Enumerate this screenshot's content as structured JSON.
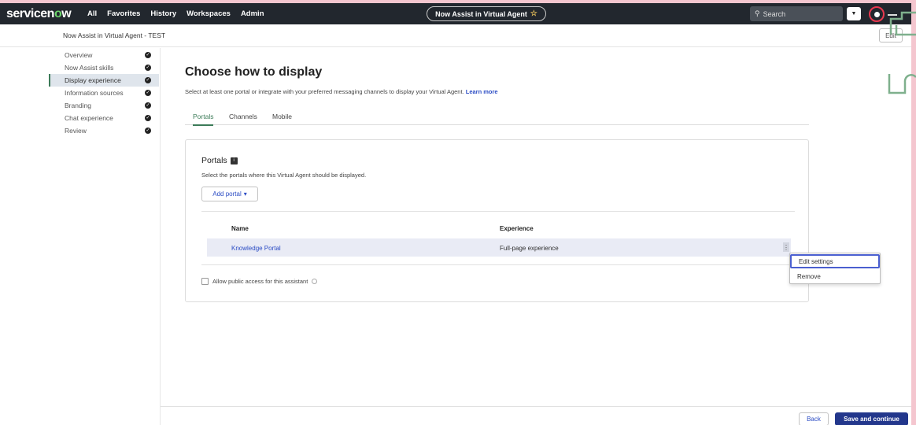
{
  "topnav": {
    "logo_pre": "servicen",
    "logo_o": "o",
    "logo_post": "w",
    "items": [
      "All",
      "Favorites",
      "History",
      "Workspaces",
      "Admin"
    ],
    "context_pill": "Now Assist in Virtual Agent",
    "search_placeholder": "Search"
  },
  "header": {
    "title": "Now Assist in Virtual Agent - TEST",
    "edit_label": "Edit"
  },
  "steps": [
    {
      "label": "Overview",
      "done": true
    },
    {
      "label": "Now Assist skills",
      "done": true
    },
    {
      "label": "Display experience",
      "done": true,
      "active": true
    },
    {
      "label": "Information sources",
      "done": true
    },
    {
      "label": "Branding",
      "done": true
    },
    {
      "label": "Chat experience",
      "done": true
    },
    {
      "label": "Review",
      "done": true
    }
  ],
  "main": {
    "title": "Choose how to display",
    "description": "Select at least one portal or integrate with your preferred messaging channels to display your Virtual Agent.",
    "learn_more": "Learn more",
    "tabs": [
      "Portals",
      "Channels",
      "Mobile"
    ],
    "active_tab": "Portals"
  },
  "portals": {
    "title": "Portals",
    "subtitle": "Select the portals where this Virtual Agent should be displayed.",
    "add_button": "Add portal",
    "columns": [
      "Name",
      "Experience"
    ],
    "rows": [
      {
        "name": "Knowledge Portal",
        "experience": "Full-page experience"
      }
    ],
    "public_access_label": "Allow public access for this assistant"
  },
  "row_menu": {
    "items": [
      "Edit settings",
      "Remove"
    ]
  },
  "footer": {
    "back_label": "Back",
    "save_label": "Save and continue"
  },
  "colors": {
    "accent_green": "#3c7b58",
    "primary_button": "#23378c",
    "link_blue": "#2b4cc4",
    "nav_bg": "#22272e",
    "outer_bg": "#f4c6cf"
  }
}
